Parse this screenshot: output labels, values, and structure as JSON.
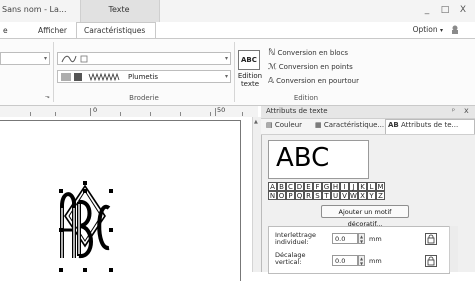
{
  "window": {
    "title": "Sans nom - La...",
    "context_tab": "Texte",
    "controls": [
      "_",
      "□",
      "X"
    ]
  },
  "ribbon_tabs": {
    "left_partial": "e",
    "afficher": "Afficher",
    "active": "Caractéristiques",
    "option": "Option",
    "help_arrow": "▾"
  },
  "broderie_group": {
    "stitch_label": "Plumetis",
    "caption": "Broderie"
  },
  "edition_group": {
    "button_line1": "Edition",
    "button_line2": "texte",
    "abc": "ABC",
    "items": [
      "Conversion en blocs",
      "Conversion en points",
      "Conversion en pourtour"
    ],
    "caption": "Edition"
  },
  "ruler": {
    "labels": [
      "0",
      "50"
    ]
  },
  "panel": {
    "title": "Attributs de texte",
    "pin": "ᵖ",
    "close": "x",
    "tabs": [
      "Couleur",
      "Caractéristique...",
      "Attributs de te..."
    ],
    "preview_text": "ABC",
    "glyph_rows": [
      [
        "A",
        "B",
        "C",
        "D",
        "E",
        "F",
        "G",
        "H",
        "I",
        "J",
        "K",
        "L",
        "M"
      ],
      [
        "N",
        "O",
        "P",
        "Q",
        "R",
        "S",
        "T",
        "U",
        "V",
        "W",
        "X",
        "Y",
        "Z"
      ]
    ],
    "add_button": "Ajouter un motif décoratif...",
    "properties": [
      {
        "label1": "Interlettrage",
        "label2": "individuel:",
        "value": "0.0",
        "unit": "mm"
      },
      {
        "label1": "Décalage",
        "label2": "vertical:",
        "value": "0.0",
        "unit": "mm"
      }
    ]
  }
}
